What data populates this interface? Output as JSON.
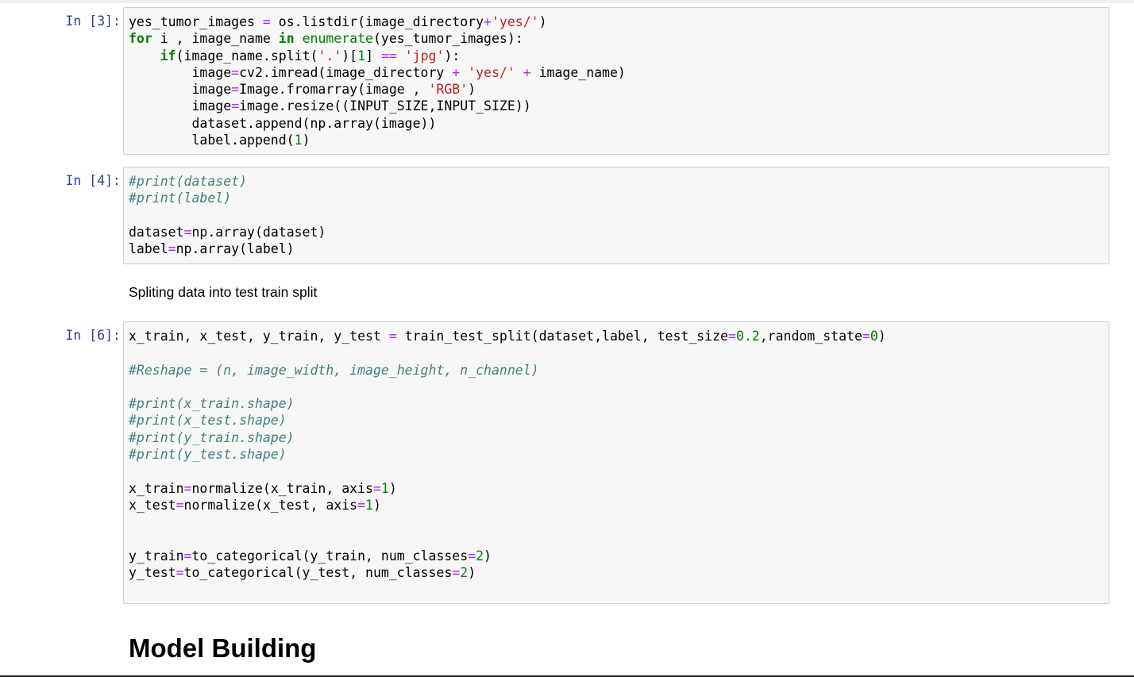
{
  "cells": [
    {
      "prompt": "In [3]:",
      "lines": [
        [
          [
            "n",
            "yes_tumor_images "
          ],
          [
            "op",
            "="
          ],
          [
            "n",
            " os.listdir(image_directory"
          ],
          [
            "op",
            "+"
          ],
          [
            "st",
            "'yes/'"
          ],
          [
            "n",
            ")"
          ]
        ],
        [
          [
            "kw",
            "for"
          ],
          [
            "n",
            " i , image_name "
          ],
          [
            "kw",
            "in"
          ],
          [
            "n",
            " "
          ],
          [
            "bi",
            "enumerate"
          ],
          [
            "n",
            "(yes_tumor_images):"
          ]
        ],
        [
          [
            "n",
            "    "
          ],
          [
            "kw",
            "if"
          ],
          [
            "n",
            "(image_name.split("
          ],
          [
            "st",
            "'.'"
          ],
          [
            "n",
            ")["
          ],
          [
            "nu",
            "1"
          ],
          [
            "n",
            "] "
          ],
          [
            "op",
            "=="
          ],
          [
            "n",
            " "
          ],
          [
            "st",
            "'jpg'"
          ],
          [
            "n",
            "):"
          ]
        ],
        [
          [
            "n",
            "        image"
          ],
          [
            "op",
            "="
          ],
          [
            "n",
            "cv2.imread(image_directory "
          ],
          [
            "op",
            "+"
          ],
          [
            "n",
            " "
          ],
          [
            "st",
            "'yes/'"
          ],
          [
            "n",
            " "
          ],
          [
            "op",
            "+"
          ],
          [
            "n",
            " image_name)"
          ]
        ],
        [
          [
            "n",
            "        image"
          ],
          [
            "op",
            "="
          ],
          [
            "n",
            "Image.fromarray(image , "
          ],
          [
            "st",
            "'RGB'"
          ],
          [
            "n",
            ")"
          ]
        ],
        [
          [
            "n",
            "        image"
          ],
          [
            "op",
            "="
          ],
          [
            "n",
            "image.resize((INPUT_SIZE,INPUT_SIZE))"
          ]
        ],
        [
          [
            "n",
            "        dataset.append(np.array(image))"
          ]
        ],
        [
          [
            "n",
            "        label.append("
          ],
          [
            "nu",
            "1"
          ],
          [
            "n",
            ")"
          ]
        ]
      ]
    },
    {
      "prompt": "In [4]:",
      "lines": [
        [
          [
            "cm",
            "#print(dataset)"
          ]
        ],
        [
          [
            "cm",
            "#print(label)"
          ]
        ],
        [
          [
            "n",
            ""
          ]
        ],
        [
          [
            "n",
            "dataset"
          ],
          [
            "op",
            "="
          ],
          [
            "n",
            "np.array(dataset)"
          ]
        ],
        [
          [
            "n",
            "label"
          ],
          [
            "op",
            "="
          ],
          [
            "n",
            "np.array(label)"
          ]
        ]
      ]
    },
    {
      "prompt": "In [6]:",
      "lines": [
        [
          [
            "n",
            "x_train, x_test, y_train, y_test "
          ],
          [
            "op",
            "="
          ],
          [
            "n",
            " train_test_split(dataset,label, test_size"
          ],
          [
            "op",
            "="
          ],
          [
            "nu",
            "0.2"
          ],
          [
            "n",
            ",random_state"
          ],
          [
            "op",
            "="
          ],
          [
            "nu",
            "0"
          ],
          [
            "n",
            ")"
          ]
        ],
        [
          [
            "n",
            ""
          ]
        ],
        [
          [
            "cm",
            "#Reshape = (n, image_width, image_height, n_channel)"
          ]
        ],
        [
          [
            "n",
            ""
          ]
        ],
        [
          [
            "cm",
            "#print(x_train.shape)"
          ]
        ],
        [
          [
            "cm",
            "#print(x_test.shape)"
          ]
        ],
        [
          [
            "cm",
            "#print(y_train.shape)"
          ]
        ],
        [
          [
            "cm",
            "#print(y_test.shape)"
          ]
        ],
        [
          [
            "n",
            ""
          ]
        ],
        [
          [
            "n",
            "x_train"
          ],
          [
            "op",
            "="
          ],
          [
            "n",
            "normalize(x_train, axis"
          ],
          [
            "op",
            "="
          ],
          [
            "nu",
            "1"
          ],
          [
            "n",
            ")"
          ]
        ],
        [
          [
            "n",
            "x_test"
          ],
          [
            "op",
            "="
          ],
          [
            "n",
            "normalize(x_test, axis"
          ],
          [
            "op",
            "="
          ],
          [
            "nu",
            "1"
          ],
          [
            "n",
            ")"
          ]
        ],
        [
          [
            "n",
            ""
          ]
        ],
        [
          [
            "n",
            ""
          ]
        ],
        [
          [
            "n",
            "y_train"
          ],
          [
            "op",
            "="
          ],
          [
            "n",
            "to_categorical(y_train, num_classes"
          ],
          [
            "op",
            "="
          ],
          [
            "nu",
            "2"
          ],
          [
            "n",
            ")"
          ]
        ],
        [
          [
            "n",
            "y_test"
          ],
          [
            "op",
            "="
          ],
          [
            "n",
            "to_categorical(y_test, num_classes"
          ],
          [
            "op",
            "="
          ],
          [
            "nu",
            "2"
          ],
          [
            "n",
            ")"
          ]
        ]
      ]
    }
  ],
  "markdown": {
    "split_text": "Spliting data into test train split",
    "heading": "Model Building"
  }
}
